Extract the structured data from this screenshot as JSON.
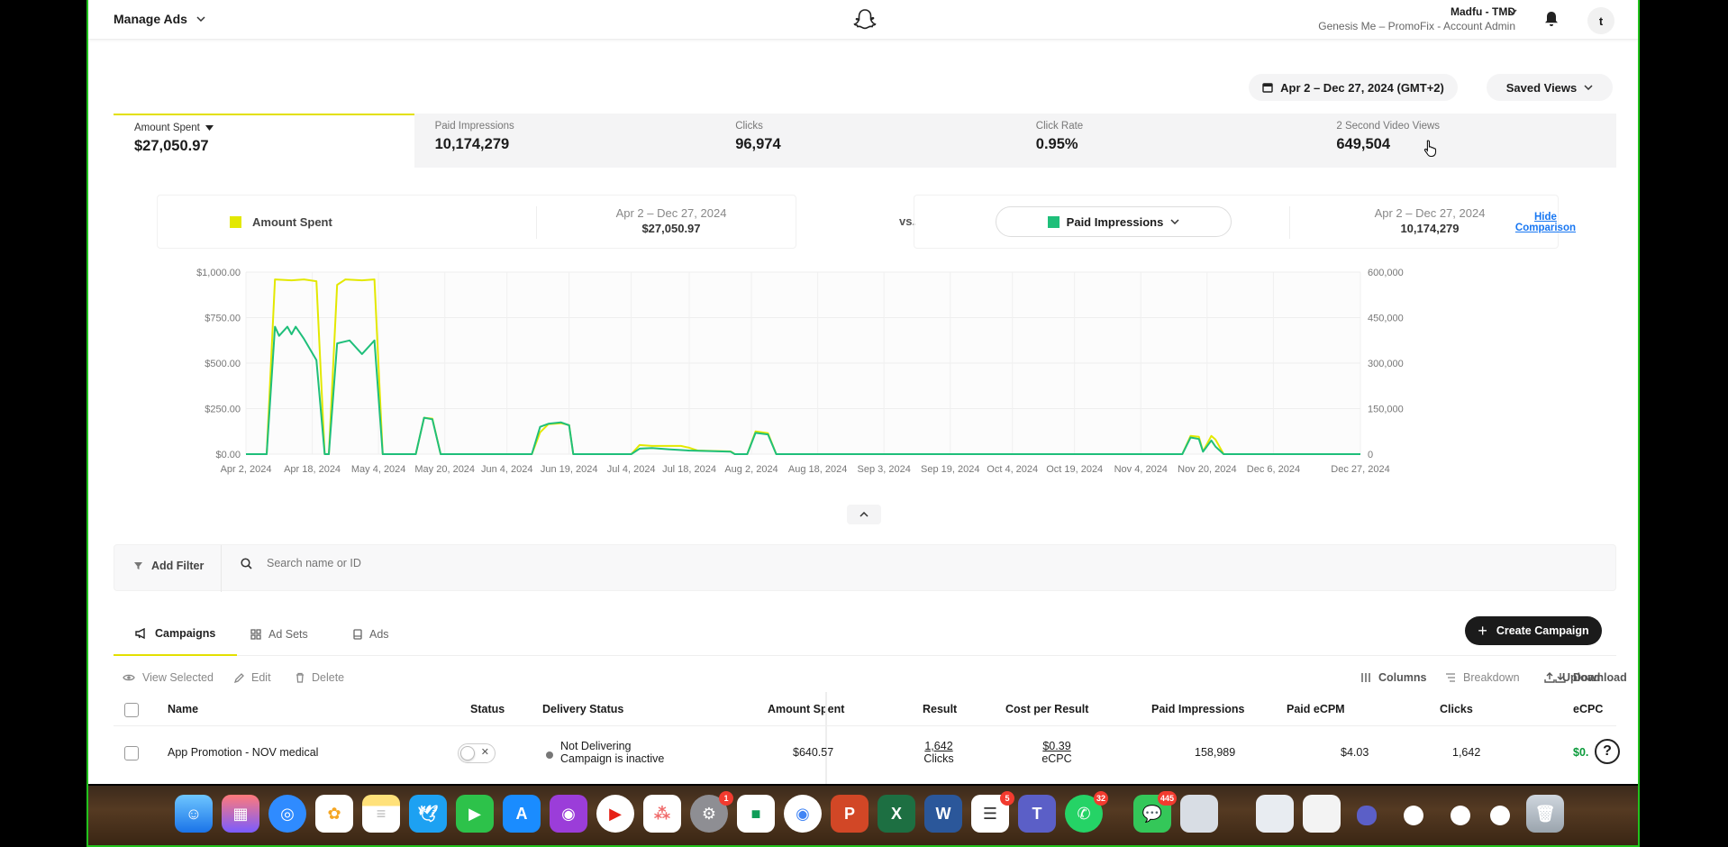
{
  "header": {
    "manage_label": "Manage Ads",
    "account_name": "Madfu - TMD",
    "account_sub": "Genesis Me – PromoFix - Account Admin",
    "avatar_letter": "t"
  },
  "controls": {
    "date_range": "Apr 2 – Dec 27, 2024 (GMT+2)",
    "saved_views": "Saved Views"
  },
  "metrics": [
    {
      "label": "Amount Spent",
      "value": "$27,050.97"
    },
    {
      "label": "Paid Impressions",
      "value": "10,174,279"
    },
    {
      "label": "Clicks",
      "value": "96,974"
    },
    {
      "label": "Click Rate",
      "value": "0.95%"
    },
    {
      "label": "2 Second Video Views",
      "value": "649,504"
    }
  ],
  "comparison": {
    "left_label": "Amount Spent",
    "left_range": "Apr 2 – Dec 27, 2024",
    "left_value": "$27,050.97",
    "vs": "vs.",
    "right_label": "Paid Impressions",
    "right_range": "Apr 2 – Dec 27, 2024",
    "right_value": "10,174,279",
    "hide_line1": "Hide",
    "hide_line2": "Comparison",
    "colors": {
      "amount_spent": "#e3e800",
      "paid_impressions": "#1fbf7a"
    }
  },
  "chart_data": {
    "type": "line",
    "x_ticks": [
      "Apr 2, 2024",
      "Apr 18, 2024",
      "May 4, 2024",
      "May 20, 2024",
      "Jun 4, 2024",
      "Jun 19, 2024",
      "Jul 4, 2024",
      "Jul 18, 2024",
      "Aug 2, 2024",
      "Aug 18, 2024",
      "Sep 3, 2024",
      "Sep 19, 2024",
      "Oct 4, 2024",
      "Oct 19, 2024",
      "Nov 4, 2024",
      "Nov 20, 2024",
      "Dec 6, 2024",
      "Dec 27, 2024"
    ],
    "y_left_ticks": [
      "$1,000.00",
      "$750.00",
      "$500.00",
      "$250.00",
      "$0.00"
    ],
    "y_right_ticks": [
      "600,000",
      "450,000",
      "300,000",
      "150,000",
      "0"
    ],
    "ylim_left": [
      0,
      1000
    ],
    "ylim_right": [
      0,
      600000
    ],
    "grid": true,
    "series": [
      {
        "name": "Amount Spent",
        "axis": "left",
        "points": [
          [
            "2024-04-02",
            0
          ],
          [
            "2024-04-07",
            0
          ],
          [
            "2024-04-09",
            960
          ],
          [
            "2024-04-13",
            955
          ],
          [
            "2024-04-16",
            960
          ],
          [
            "2024-04-19",
            950
          ],
          [
            "2024-04-21",
            0
          ],
          [
            "2024-04-22",
            0
          ],
          [
            "2024-04-24",
            930
          ],
          [
            "2024-04-26",
            960
          ],
          [
            "2024-04-30",
            955
          ],
          [
            "2024-05-03",
            960
          ],
          [
            "2024-05-05",
            0
          ],
          [
            "2024-05-13",
            0
          ],
          [
            "2024-05-15",
            200
          ],
          [
            "2024-05-17",
            195
          ],
          [
            "2024-05-19",
            0
          ],
          [
            "2024-06-10",
            0
          ],
          [
            "2024-06-12",
            120
          ],
          [
            "2024-06-14",
            165
          ],
          [
            "2024-06-17",
            170
          ],
          [
            "2024-06-19",
            160
          ],
          [
            "2024-06-20",
            0
          ],
          [
            "2024-07-04",
            0
          ],
          [
            "2024-07-06",
            50
          ],
          [
            "2024-07-09",
            45
          ],
          [
            "2024-07-11",
            45
          ],
          [
            "2024-07-16",
            45
          ],
          [
            "2024-07-18",
            35
          ],
          [
            "2024-07-20",
            20
          ],
          [
            "2024-07-28",
            15
          ],
          [
            "2024-07-29",
            0
          ],
          [
            "2024-08-01",
            0
          ],
          [
            "2024-08-03",
            125
          ],
          [
            "2024-08-06",
            115
          ],
          [
            "2024-08-08",
            0
          ],
          [
            "2024-11-14",
            0
          ],
          [
            "2024-11-16",
            100
          ],
          [
            "2024-11-18",
            95
          ],
          [
            "2024-11-19",
            15
          ],
          [
            "2024-11-21",
            100
          ],
          [
            "2024-11-22",
            80
          ],
          [
            "2024-11-24",
            0
          ],
          [
            "2024-12-27",
            0
          ]
        ]
      },
      {
        "name": "Paid Impressions",
        "axis": "right",
        "points": [
          [
            "2024-04-02",
            0
          ],
          [
            "2024-04-07",
            0
          ],
          [
            "2024-04-09",
            420000
          ],
          [
            "2024-04-10",
            390000
          ],
          [
            "2024-04-12",
            420000
          ],
          [
            "2024-04-13",
            395000
          ],
          [
            "2024-04-14",
            420000
          ],
          [
            "2024-04-16",
            380000
          ],
          [
            "2024-04-19",
            310000
          ],
          [
            "2024-04-21",
            0
          ],
          [
            "2024-04-22",
            0
          ],
          [
            "2024-04-24",
            365000
          ],
          [
            "2024-04-27",
            375000
          ],
          [
            "2024-04-30",
            330000
          ],
          [
            "2024-05-01",
            345000
          ],
          [
            "2024-05-03",
            375000
          ],
          [
            "2024-05-05",
            0
          ],
          [
            "2024-05-13",
            0
          ],
          [
            "2024-05-15",
            120000
          ],
          [
            "2024-05-17",
            115000
          ],
          [
            "2024-05-19",
            0
          ],
          [
            "2024-06-10",
            0
          ],
          [
            "2024-06-12",
            90000
          ],
          [
            "2024-06-14",
            100000
          ],
          [
            "2024-06-17",
            105000
          ],
          [
            "2024-06-19",
            95000
          ],
          [
            "2024-06-20",
            0
          ],
          [
            "2024-07-04",
            0
          ],
          [
            "2024-07-06",
            18000
          ],
          [
            "2024-07-09",
            20000
          ],
          [
            "2024-07-13",
            16000
          ],
          [
            "2024-07-18",
            12000
          ],
          [
            "2024-07-28",
            8000
          ],
          [
            "2024-07-29",
            0
          ],
          [
            "2024-08-01",
            0
          ],
          [
            "2024-08-03",
            70000
          ],
          [
            "2024-08-06",
            65000
          ],
          [
            "2024-08-08",
            0
          ],
          [
            "2024-11-14",
            0
          ],
          [
            "2024-11-16",
            55000
          ],
          [
            "2024-11-18",
            50000
          ],
          [
            "2024-11-19",
            8000
          ],
          [
            "2024-11-21",
            45000
          ],
          [
            "2024-11-22",
            25000
          ],
          [
            "2024-11-24",
            0
          ],
          [
            "2024-12-27",
            0
          ]
        ]
      }
    ]
  },
  "filters": {
    "add_filter": "Add Filter",
    "search_placeholder": "Search name or ID"
  },
  "tabs": [
    "Campaigns",
    "Ad Sets",
    "Ads"
  ],
  "create_campaign": "Create Campaign",
  "toolbar": {
    "view_selected": "View Selected",
    "edit": "Edit",
    "delete": "Delete",
    "columns": "Columns",
    "breakdown": "Breakdown",
    "upload": "Upload",
    "download": "Download"
  },
  "table": {
    "headers": [
      "Name",
      "Status",
      "Delivery Status",
      "Amount Spent",
      "Result",
      "Cost per Result",
      "Paid Impressions",
      "Paid eCPM",
      "Clicks",
      "eCPC"
    ],
    "rows": [
      {
        "name": "App Promotion - NOV medical",
        "delivery_1": "Not Delivering",
        "delivery_2": "Campaign is inactive",
        "amount_spent": "$640.57",
        "result_value": "1,642",
        "result_unit": "Clicks",
        "cpr_value": "$0.39",
        "cpr_unit": "eCPC",
        "paid_impressions": "158,989",
        "paid_ecpm": "$4.03",
        "clicks": "1,642",
        "ecpc": "$0."
      }
    ]
  },
  "dock": {
    "badges": {
      "settings": "1",
      "reminders": "5",
      "teams": "32",
      "whatsapp": "445"
    }
  }
}
